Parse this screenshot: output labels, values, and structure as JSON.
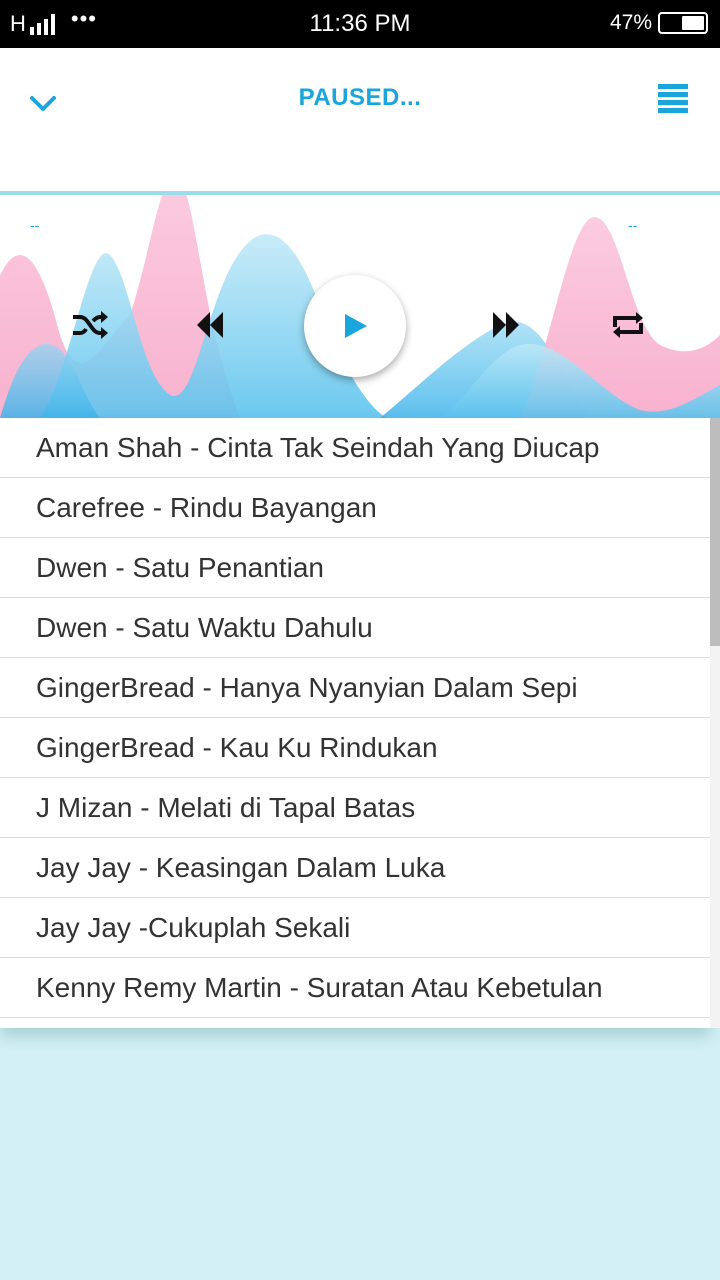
{
  "status_bar": {
    "network": "H",
    "dots": "•••",
    "time": "11:36 PM",
    "battery": "47%",
    "battery_level": 0.47
  },
  "header": {
    "title": "PAUSED...",
    "collapse_icon": "chevron-down-icon",
    "menu_icon": "menu-icon"
  },
  "player": {
    "elapsed": "--",
    "duration": "--",
    "controls": [
      "shuffle-icon",
      "rewind-icon",
      "play-icon",
      "fast-forward-icon",
      "repeat-icon"
    ],
    "accent_color": "#1aa6dc"
  },
  "songs": [
    "Aman Shah - Cinta Tak Seindah Yang Diucap",
    "Carefree - Rindu Bayangan",
    "Dwen - Satu Penantian",
    "Dwen - Satu Waktu Dahulu",
    "GingerBread - Hanya Nyanyian Dalam Sepi",
    "GingerBread - Kau Ku Rindukan",
    "J Mizan - Melati di Tapal Batas",
    "Jay Jay - Keasingan Dalam Luka",
    "Jay Jay -Cukuplah Sekali",
    "Kenny Remy Martin - Suratan Atau Kebetulan"
  ]
}
